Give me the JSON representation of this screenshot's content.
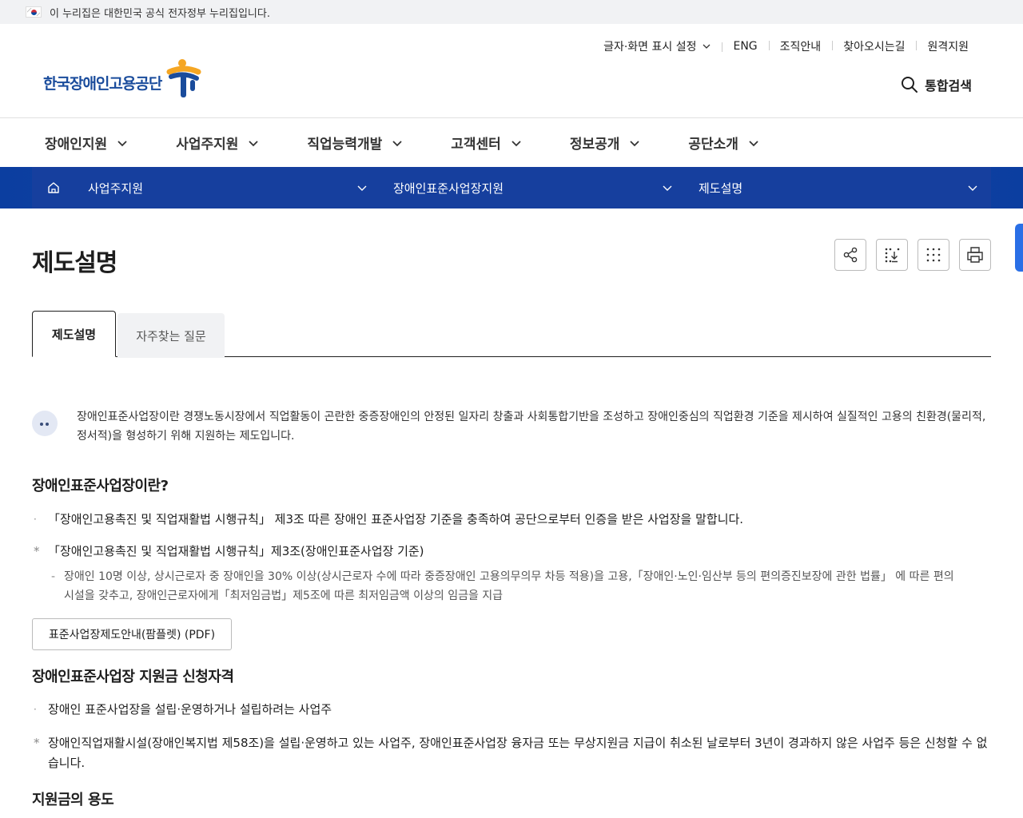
{
  "gov_banner": {
    "text": "이 누리집은 대한민국 공식 전자정부 누리집입니다."
  },
  "utility": {
    "display_settings": "글자·화면 표시 설정",
    "eng": "ENG",
    "org": "조직안내",
    "directions": "찾아오시는길",
    "remote": "원격지원"
  },
  "logo": {
    "text": "한국장애인고용공단"
  },
  "search": {
    "label": "통합검색"
  },
  "gnb": [
    "장애인지원",
    "사업주지원",
    "직업능력개발",
    "고객센터",
    "정보공개",
    "공단소개"
  ],
  "breadcrumb": {
    "level1": "사업주지원",
    "level2": "장애인표준사업장지원",
    "level3": "제도설명"
  },
  "page": {
    "title": "제도설명"
  },
  "tabs": {
    "active": "제도설명",
    "inactive": "자주찾는 질문"
  },
  "intro": {
    "text": "장애인표준사업장이란 경쟁노동시장에서 직업활동이 곤란한 중증장애인의 안정된 일자리 창출과 사회통합기반을 조성하고 장애인중심의 직업환경 기준을 제시하여 실질적인 고용의 친환경(물리적, 정서적)을 형성하기 위해 지원하는 제도입니다."
  },
  "section1": {
    "heading": "장애인표준사업장이란?",
    "bullet1": "「장애인고용촉진 및 직업재활법 시행규칙」 제3조 따른 장애인 표준사업장 기준을 충족하여 공단으로부터 인증을 받은 사업장을 말합니다.",
    "note": "「장애인고용촉진 및 직업재활법 시행규칙」제3조(장애인표준사업장 기준)",
    "sub": "장애인 10명 이상, 상시근로자 중 장애인을 30% 이상(상시근로자 수에 따라 중증장애인 고용의무의무 차등 적용)을 고용,「장애인·노인·임산부 등의 편의증진보장에 관한 법률」 에 따른 편의시설을 갖추고, 장애인근로자에게「최저임금법」제5조에 따른 최저임금액 이상의 임금을 지급",
    "pdf_button": "표준사업장제도안내(팜플렛) (PDF)"
  },
  "section2": {
    "heading": "장애인표준사업장 지원금 신청자격",
    "bullet1": "장애인 표준사업장을 설립·운영하거나 설립하려는 사업주",
    "note": "장애인직업재활시설(장애인복지법 제58조)을 설립·운영하고 있는 사업주, 장애인표준사업장 융자금 또는 무상지원금 지급이 취소된 날로부터 3년이 경과하지 않은 사업주 등은 신청할 수 없습니다."
  },
  "section3": {
    "heading": "지원금의 용도"
  },
  "markers": {
    "dot": "·",
    "star": "*",
    "dash": "-"
  },
  "colors": {
    "primary": "#163f9e",
    "logo": "#1a4c9c",
    "accent": "#f5a623"
  }
}
